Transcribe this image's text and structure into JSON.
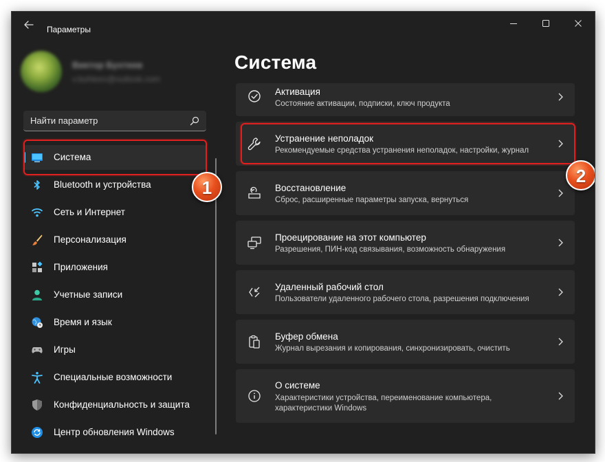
{
  "window": {
    "title": "Параметры"
  },
  "profile": {
    "name": "Виктор Бухтеев",
    "email": "v.buhteev@outlook.com"
  },
  "search": {
    "placeholder": "Найти параметр"
  },
  "sidebar": {
    "items": [
      {
        "label": "Система",
        "icon": "monitor-icon",
        "selected": true
      },
      {
        "label": "Bluetooth и устройства",
        "icon": "bluetooth-icon"
      },
      {
        "label": "Сеть и Интернет",
        "icon": "wifi-icon"
      },
      {
        "label": "Персонализация",
        "icon": "brush-icon"
      },
      {
        "label": "Приложения",
        "icon": "apps-icon"
      },
      {
        "label": "Учетные записи",
        "icon": "account-icon"
      },
      {
        "label": "Время и язык",
        "icon": "globe-clock-icon"
      },
      {
        "label": "Игры",
        "icon": "gamepad-icon"
      },
      {
        "label": "Специальные возможности",
        "icon": "accessibility-icon"
      },
      {
        "label": "Конфиденциальность и защита",
        "icon": "shield-icon"
      },
      {
        "label": "Центр обновления Windows",
        "icon": "update-icon"
      }
    ]
  },
  "main": {
    "title": "Система",
    "cards": [
      {
        "title": "Активация",
        "description": "Состояние активации, подписки, ключ продукта",
        "icon": "check-circle-icon"
      },
      {
        "title": "Устранение неполадок",
        "description": "Рекомендуемые средства устранения неполадок, настройки, журнал",
        "icon": "wrench-icon"
      },
      {
        "title": "Восстановление",
        "description": "Сброс, расширенные параметры запуска, вернуться",
        "icon": "recovery-icon"
      },
      {
        "title": "Проецирование на этот компьютер",
        "description": "Разрешения, ПИН-код связывания, возможность обнаружения",
        "icon": "projection-icon"
      },
      {
        "title": "Удаленный рабочий стол",
        "description": "Пользователи удаленного рабочего стола, разрешения подключения",
        "icon": "remote-desktop-icon"
      },
      {
        "title": "Буфер обмена",
        "description": "Журнал вырезания и копирования, синхронизировать, очистить",
        "icon": "clipboard-icon"
      },
      {
        "title": "О системе",
        "description": "Характеристики устройства, переименование компьютера, характеристики Windows",
        "icon": "info-icon"
      }
    ]
  },
  "annotations": {
    "badge1": "1",
    "badge2": "2"
  },
  "colors": {
    "accent": "#60cdff",
    "highlight": "#e01f1f",
    "badge": "#e8501e",
    "card": "#2b2b2b",
    "background": "#202020"
  }
}
